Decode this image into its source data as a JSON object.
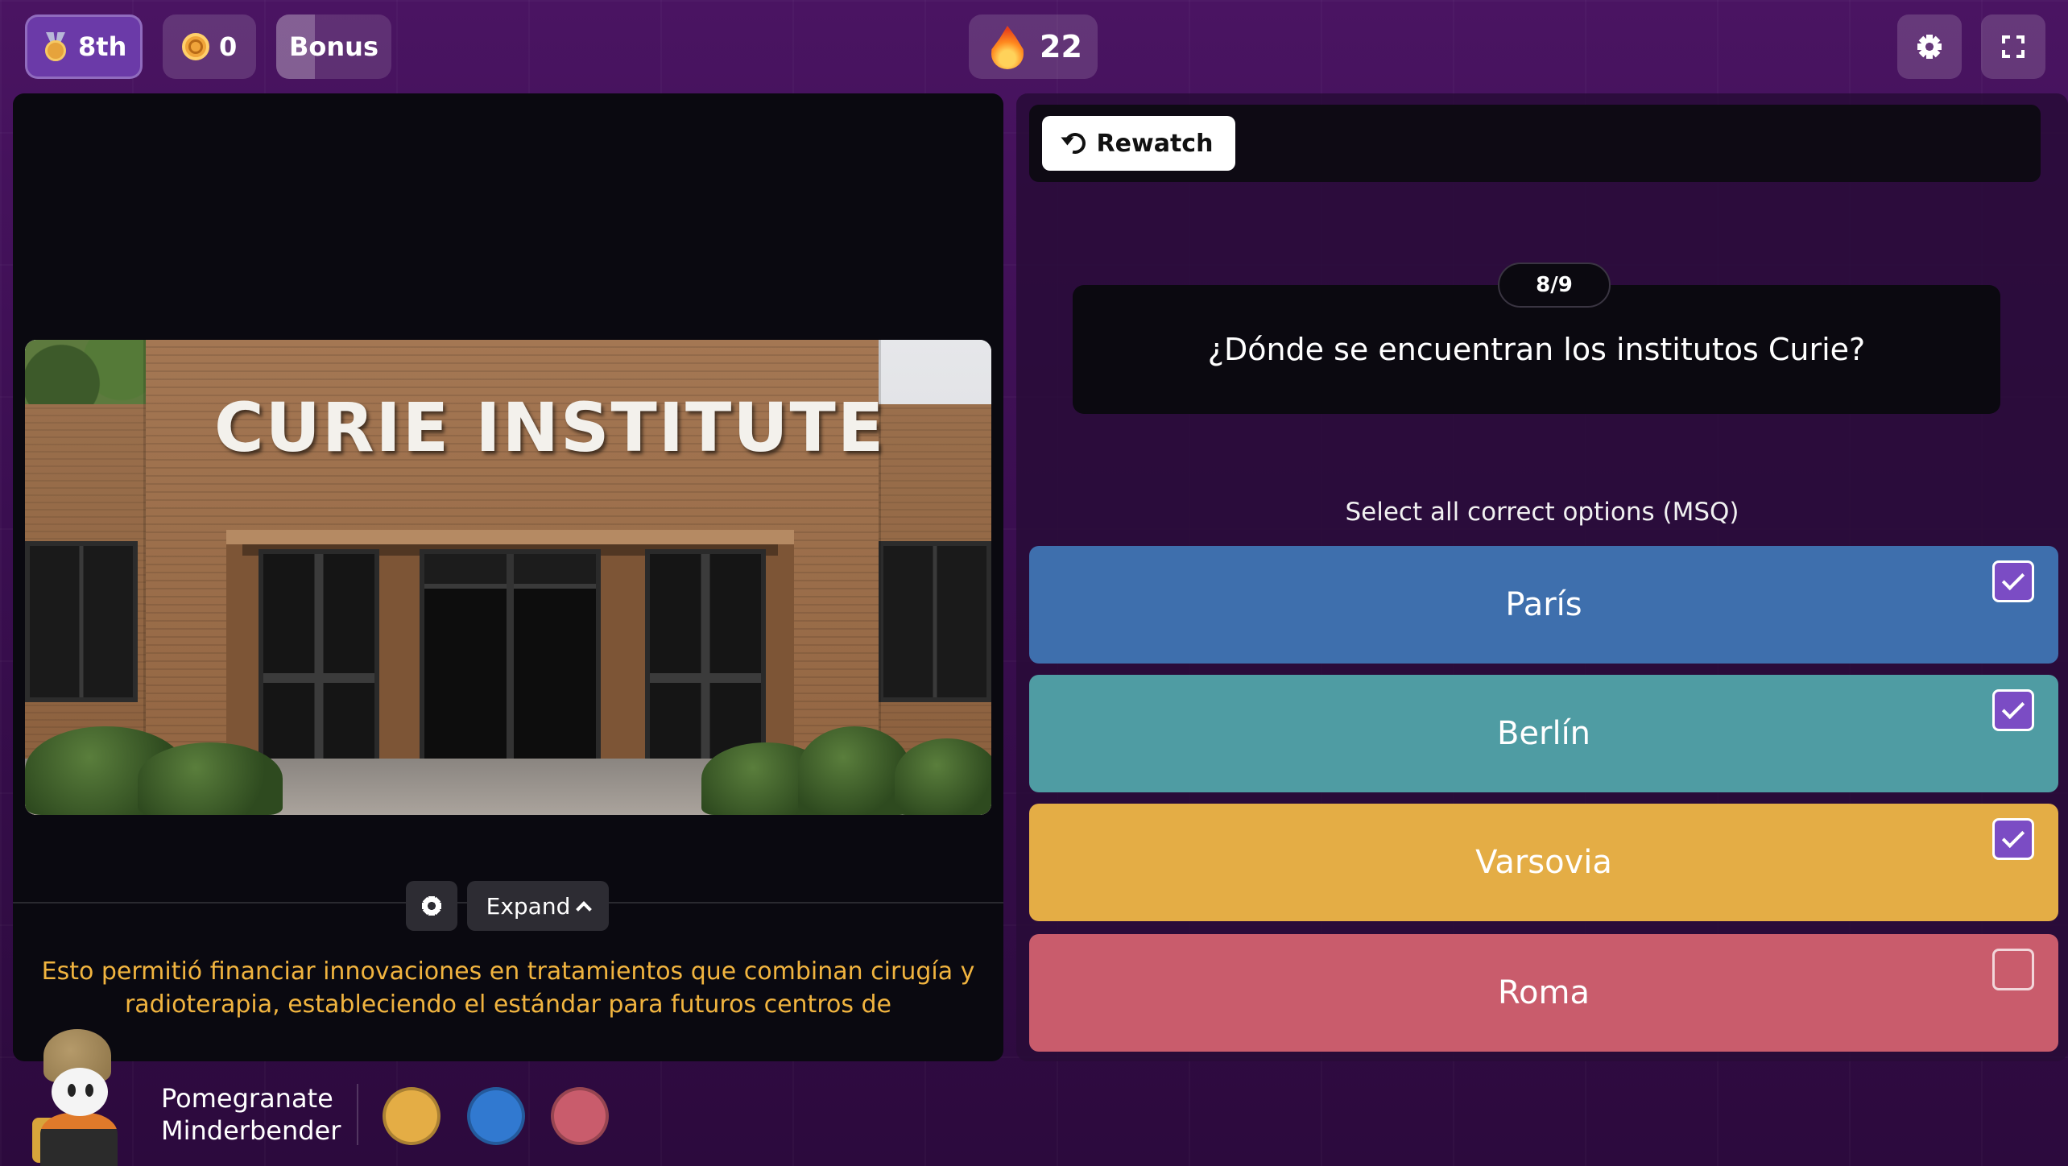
{
  "topbar": {
    "rank": "8th",
    "coins": "0",
    "bonus_label": "Bonus",
    "streak": "22",
    "icons": {
      "rank": "medal-icon",
      "coins": "coin-icon",
      "streak": "flame-icon",
      "settings": "gear-icon",
      "fullscreen": "fullscreen-icon"
    }
  },
  "media": {
    "sign_text": "CURIE INSTITUTE",
    "expand_label": "Expand",
    "caption": "Esto permitió financiar innovaciones en tratamientos que combinan cirugía y radioterapia, estableciendo el estándar para futuros centros de"
  },
  "question": {
    "rewatch_label": "Rewatch",
    "counter": "8/9",
    "text": "¿Dónde se encuentran los institutos Curie?",
    "instruction": "Select all correct options (MSQ)",
    "options": [
      {
        "label": "París",
        "checked": true,
        "color": "#3e6fad"
      },
      {
        "label": "Berlín",
        "checked": true,
        "color": "#4f9ca3"
      },
      {
        "label": "Varsovia",
        "checked": true,
        "color": "#e4ad45"
      },
      {
        "label": "Roma",
        "checked": false,
        "color": "#c95c6c"
      }
    ]
  },
  "player": {
    "name_line1": "Pomegranate",
    "name_line2": "Minderbender",
    "powerup_colors": [
      "#e4ad45",
      "#3179d0",
      "#c95c6c"
    ]
  },
  "colors": {
    "accent_purple": "#7b4cc4",
    "caption_yellow": "#f1b43f",
    "background": "#3a0f4e"
  }
}
